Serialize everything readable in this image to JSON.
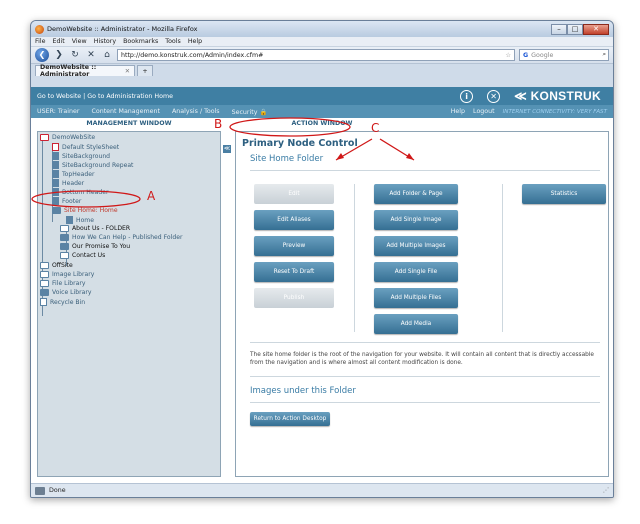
{
  "browser": {
    "title": "DemoWebsite :: Administrator - Mozilla Firefox",
    "menu": [
      "File",
      "Edit",
      "View",
      "History",
      "Bookmarks",
      "Tools",
      "Help"
    ],
    "url": "http://demo.konstruk.com/Admin/index.cfm#",
    "search_placeholder": "Google",
    "tab_label": "DemoWebsite :: Administrator",
    "new_tab": "+",
    "status": "Done"
  },
  "cms": {
    "top_links": "Go to Website  |  Go to Administration Home",
    "logo": "KONSTRUK",
    "logo_mark": "≪",
    "info_icon": "i",
    "close_icon": "✕",
    "nav": {
      "user": "USER: Trainer",
      "content": "Content Management",
      "analysis": "Analysis / Tools",
      "security": "Security",
      "help": "Help",
      "logout": "Logout",
      "connectivity": "INTERNET CONNECTIVITY: VERY FAST"
    },
    "management_header": "MANAGEMENT WINDOW",
    "action_header": "ACTION WINDOW"
  },
  "tree": {
    "items": [
      {
        "label": "DemoWebSite"
      },
      {
        "label": "Default StyleSheet"
      },
      {
        "label": "SiteBackground"
      },
      {
        "label": "SiteBackground Repeat"
      },
      {
        "label": "TopHeader"
      },
      {
        "label": "Header"
      },
      {
        "label": "Bottom Header"
      },
      {
        "label": "Footer"
      },
      {
        "label": "Site Home: Home"
      },
      {
        "label": "Home"
      },
      {
        "label": "About Us - FOLDER"
      },
      {
        "label": "How We Can Help - Published Folder"
      },
      {
        "label": "Our Promise To You"
      },
      {
        "label": "Contact Us"
      },
      {
        "label": "OffSite"
      },
      {
        "label": "Image Library"
      },
      {
        "label": "File Library"
      },
      {
        "label": "Voice Library"
      },
      {
        "label": "Recycle Bin"
      }
    ]
  },
  "action": {
    "title": "Primary Node Control",
    "subtitle": "Site Home Folder",
    "col1": [
      "Edit",
      "Edit Aliases",
      "Preview",
      "Reset To Draft",
      "Publish"
    ],
    "col2": [
      "Add Folder & Page",
      "Add Single Image",
      "Add Multiple Images",
      "Add Single File",
      "Add Multiple Files",
      "Add Media"
    ],
    "col3": [
      "Statistics"
    ],
    "description": "The site home folder is the root of the navigation for your website. It will contain all content that is directly accessable from the navigation and is where almost all content modification is done.",
    "images_title": "Images under this Folder",
    "return_button": "Return to Action Desktop"
  },
  "annotations": {
    "a": "A",
    "b": "B",
    "c": "C",
    "color": "#d01818"
  }
}
